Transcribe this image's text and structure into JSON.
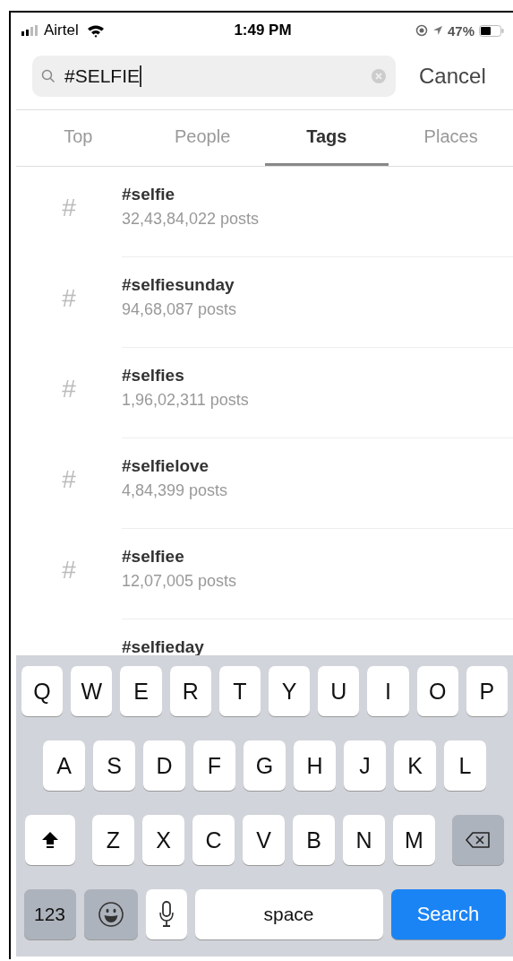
{
  "status_bar": {
    "carrier": "Airtel",
    "time": "1:49 PM",
    "battery": "47%"
  },
  "search": {
    "value": "#SELFIE",
    "cancel": "Cancel"
  },
  "tabs": [
    {
      "label": "Top",
      "selected": false
    },
    {
      "label": "People",
      "selected": false
    },
    {
      "label": "Tags",
      "selected": true
    },
    {
      "label": "Places",
      "selected": false
    }
  ],
  "results": [
    {
      "icon": "#",
      "tag": "#selfie",
      "count": "32,43,84,022 posts"
    },
    {
      "icon": "#",
      "tag": "#selfiesunday",
      "count": "94,68,087 posts"
    },
    {
      "icon": "#",
      "tag": "#selfies",
      "count": "1,96,02,311 posts"
    },
    {
      "icon": "#",
      "tag": "#selfielove",
      "count": "4,84,399 posts"
    },
    {
      "icon": "#",
      "tag": "#selfiee",
      "count": "12,07,005 posts"
    },
    {
      "tag": "#selfieday"
    }
  ],
  "keyboard": {
    "rows": [
      {
        "keys": [
          {
            "kind": "letter",
            "label": "Q"
          },
          {
            "kind": "letter",
            "label": "W"
          },
          {
            "kind": "letter",
            "label": "E"
          },
          {
            "kind": "letter",
            "label": "R"
          },
          {
            "kind": "letter",
            "label": "T"
          },
          {
            "kind": "letter",
            "label": "Y"
          },
          {
            "kind": "letter",
            "label": "U"
          },
          {
            "kind": "letter",
            "label": "I"
          },
          {
            "kind": "letter",
            "label": "O"
          },
          {
            "kind": "letter",
            "label": "P"
          }
        ]
      },
      {
        "keys": [
          {
            "kind": "letter",
            "label": "A"
          },
          {
            "kind": "letter",
            "label": "S"
          },
          {
            "kind": "letter",
            "label": "D"
          },
          {
            "kind": "letter",
            "label": "F"
          },
          {
            "kind": "letter",
            "label": "G"
          },
          {
            "kind": "letter",
            "label": "H"
          },
          {
            "kind": "letter",
            "label": "J"
          },
          {
            "kind": "letter",
            "label": "K"
          },
          {
            "kind": "letter",
            "label": "L"
          }
        ]
      },
      {
        "keys": [
          {
            "kind": "shift"
          },
          {
            "kind": "letter",
            "label": "Z"
          },
          {
            "kind": "letter",
            "label": "X"
          },
          {
            "kind": "letter",
            "label": "C"
          },
          {
            "kind": "letter",
            "label": "V"
          },
          {
            "kind": "letter",
            "label": "B"
          },
          {
            "kind": "letter",
            "label": "N"
          },
          {
            "kind": "letter",
            "label": "M"
          },
          {
            "kind": "delete"
          }
        ]
      },
      {
        "keys": [
          {
            "kind": "numbers",
            "label": "123"
          },
          {
            "kind": "emoji"
          },
          {
            "kind": "mic"
          },
          {
            "kind": "space",
            "label": "space"
          },
          {
            "kind": "search",
            "label": "Search"
          }
        ]
      }
    ]
  }
}
